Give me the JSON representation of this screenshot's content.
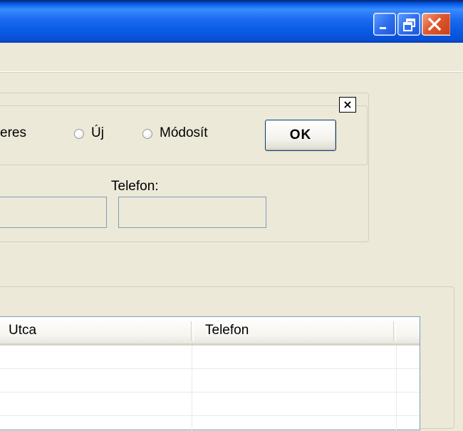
{
  "window": {
    "controls": [
      {
        "name": "minimize",
        "icon": "minimize-icon"
      },
      {
        "name": "restore",
        "icon": "restore-icon"
      },
      {
        "name": "close",
        "icon": "close-icon"
      }
    ]
  },
  "mode_panel": {
    "partial_label": "eres",
    "options": [
      {
        "label": "Új",
        "selected": false
      },
      {
        "label": "Módosít",
        "selected": false
      }
    ],
    "ok_label": "OK",
    "close_glyph": "×"
  },
  "fields": {
    "telefon_label": "Telefon:",
    "telefon_value": "",
    "left_value": ""
  },
  "grid": {
    "columns": [
      "Utca",
      "Telefon"
    ],
    "rows": [
      [
        "",
        ""
      ],
      [
        "",
        ""
      ],
      [
        "",
        ""
      ]
    ]
  },
  "colors": {
    "titlebar": "#0A5CE6",
    "window_bg": "#ECE9D8",
    "close_button": "#E0582C",
    "ok_border": "#003C74"
  }
}
